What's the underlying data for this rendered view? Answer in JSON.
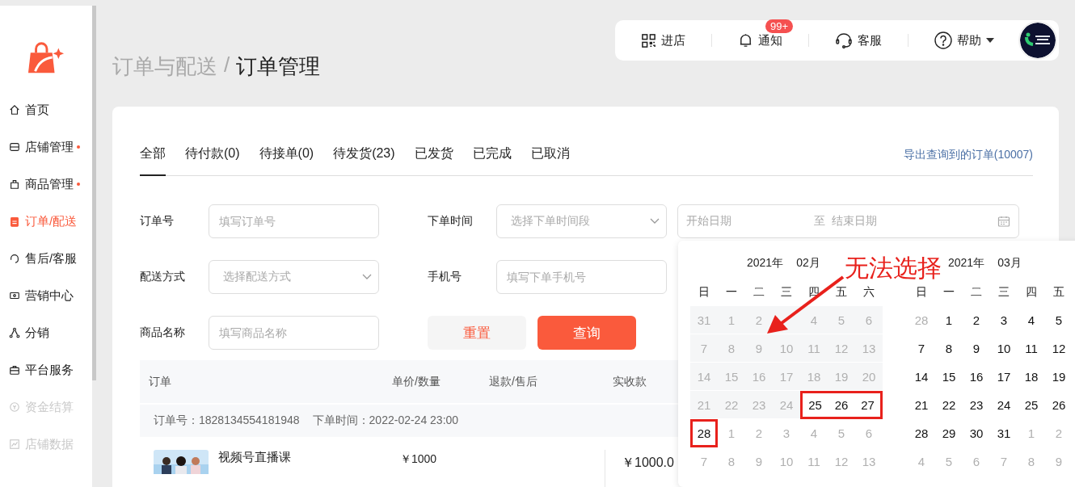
{
  "sidebar": {
    "items": [
      {
        "label": "首页",
        "dot": false,
        "selected": false,
        "disabled": false
      },
      {
        "label": "店铺管理",
        "dot": true,
        "selected": false,
        "disabled": false
      },
      {
        "label": "商品管理",
        "dot": true,
        "selected": false,
        "disabled": false
      },
      {
        "label": "订单/配送",
        "dot": false,
        "selected": true,
        "disabled": false
      },
      {
        "label": "售后/客服",
        "dot": false,
        "selected": false,
        "disabled": false
      },
      {
        "label": "营销中心",
        "dot": false,
        "selected": false,
        "disabled": false
      },
      {
        "label": "分销",
        "dot": false,
        "selected": false,
        "disabled": false
      },
      {
        "label": "平台服务",
        "dot": false,
        "selected": false,
        "disabled": false
      },
      {
        "label": "资金结算",
        "dot": false,
        "selected": false,
        "disabled": true
      },
      {
        "label": "店铺数据",
        "dot": false,
        "selected": false,
        "disabled": true
      }
    ]
  },
  "toolbar": [
    {
      "label": "进店"
    },
    {
      "label": "通知",
      "badge": "99+"
    },
    {
      "label": "客服"
    },
    {
      "label": "帮助",
      "dropdown": true
    }
  ],
  "breadcrumb": {
    "parent": "订单与配送",
    "separator": "/",
    "current": "订单管理"
  },
  "tabs": [
    {
      "label": "全部",
      "selected": true
    },
    {
      "label": "待付款(0)",
      "selected": false
    },
    {
      "label": "待接单(0)",
      "selected": false
    },
    {
      "label": "待发货(23)",
      "selected": false
    },
    {
      "label": "已发货",
      "selected": false
    },
    {
      "label": "已完成",
      "selected": false
    },
    {
      "label": "已取消",
      "selected": false
    }
  ],
  "export_link": "导出查询到的订单(10007)",
  "filters": {
    "order_no": {
      "label": "订单号",
      "placeholder": "填写订单号"
    },
    "order_time": {
      "label": "下单时间",
      "placeholder": "选择下单时间段",
      "start_placeholder": "开始日期",
      "range_separator": "至",
      "end_placeholder": "结束日期"
    },
    "delivery": {
      "label": "配送方式",
      "placeholder": "选择配送方式"
    },
    "phone": {
      "label": "手机号",
      "placeholder": "填写下单手机号"
    },
    "product": {
      "label": "商品名称",
      "placeholder": "填写商品名称"
    },
    "buttons": [
      "重置",
      "查询"
    ]
  },
  "table": {
    "columns": [
      "订单",
      "单价/数量",
      "退款/售后",
      "实收款"
    ],
    "order": {
      "no_label": "订单号：",
      "no": "1828134554181948",
      "time_label": "下单时间：",
      "time": "2022-02-24 23:00"
    },
    "item": {
      "name": "视频号直播课",
      "price": "￥1000",
      "paid": "￥1000.0"
    }
  },
  "calendar": {
    "months": [
      {
        "year": "2021年",
        "month": "02月",
        "weekdays": [
          "日",
          "一",
          "二",
          "三",
          "四",
          "五",
          "六"
        ],
        "weeks": [
          [
            {
              "day": "31",
              "kind": "disabled",
              "circled": false
            },
            {
              "day": "1",
              "kind": "disabled",
              "circled": false
            },
            {
              "day": "2",
              "kind": "disabled",
              "circled": false
            },
            {
              "kind": "disabled",
              "circled": false
            },
            {
              "day": "4",
              "kind": "disabled",
              "circled": false
            },
            {
              "day": "5",
              "kind": "disabled",
              "circled": false
            },
            {
              "day": "6",
              "kind": "disabled",
              "circled": false
            }
          ],
          [
            {
              "day": "7",
              "kind": "disabled",
              "circled": false
            },
            {
              "day": "8",
              "kind": "disabled",
              "circled": false
            },
            {
              "day": "9",
              "kind": "disabled",
              "circled": false
            },
            {
              "day": "10",
              "kind": "disabled",
              "circled": false
            },
            {
              "day": "11",
              "kind": "disabled",
              "circled": false
            },
            {
              "day": "12",
              "kind": "disabled",
              "circled": false
            },
            {
              "day": "13",
              "kind": "disabled",
              "circled": false
            }
          ],
          [
            {
              "day": "14",
              "kind": "disabled",
              "circled": false
            },
            {
              "day": "15",
              "kind": "disabled",
              "circled": false
            },
            {
              "day": "16",
              "kind": "disabled",
              "circled": false
            },
            {
              "day": "17",
              "kind": "disabled",
              "circled": false
            },
            {
              "day": "18",
              "kind": "disabled",
              "circled": false
            },
            {
              "day": "19",
              "kind": "disabled",
              "circled": false
            },
            {
              "day": "20",
              "kind": "disabled",
              "circled": false
            }
          ],
          [
            {
              "day": "21",
              "kind": "disabled",
              "circled": false
            },
            {
              "day": "22",
              "kind": "disabled",
              "circled": false
            },
            {
              "day": "23",
              "kind": "disabled",
              "circled": false
            },
            {
              "day": "24",
              "kind": "disabled",
              "circled": false
            },
            {
              "day": "25",
              "kind": "normal",
              "circled": true
            },
            {
              "day": "26",
              "kind": "normal",
              "circled": true
            },
            {
              "day": "27",
              "kind": "normal",
              "circled": true
            }
          ],
          [
            {
              "day": "28",
              "kind": "normal",
              "circled": true
            },
            {
              "day": "1",
              "kind": "outside",
              "circled": false
            },
            {
              "day": "2",
              "kind": "outside",
              "circled": false
            },
            {
              "day": "3",
              "kind": "outside",
              "circled": false
            },
            {
              "day": "4",
              "kind": "outside",
              "circled": false
            },
            {
              "day": "5",
              "kind": "outside",
              "circled": false
            },
            {
              "day": "6",
              "kind": "outside",
              "circled": false
            }
          ],
          [
            {
              "day": "7",
              "kind": "outside",
              "circled": false
            },
            {
              "day": "8",
              "kind": "outside",
              "circled": false
            },
            {
              "day": "9",
              "kind": "outside",
              "circled": false
            },
            {
              "day": "10",
              "kind": "outside",
              "circled": false
            },
            {
              "day": "11",
              "kind": "outside",
              "circled": false
            },
            {
              "day": "12",
              "kind": "outside",
              "circled": false
            },
            {
              "day": "13",
              "kind": "outside",
              "circled": false
            }
          ]
        ]
      },
      {
        "year": "2021年",
        "month": "03月",
        "weekdays": [
          "日",
          "一",
          "二",
          "三",
          "四",
          "五"
        ],
        "weeks": [
          [
            {
              "day": "28",
              "kind": "outside",
              "circled": false
            },
            {
              "day": "1",
              "kind": "normal",
              "circled": false
            },
            {
              "day": "2",
              "kind": "normal",
              "circled": false
            },
            {
              "day": "3",
              "kind": "normal",
              "circled": false
            },
            {
              "day": "4",
              "kind": "normal",
              "circled": false
            },
            {
              "day": "5",
              "kind": "normal",
              "circled": false
            }
          ],
          [
            {
              "day": "7",
              "kind": "normal",
              "circled": false
            },
            {
              "day": "8",
              "kind": "normal",
              "circled": false
            },
            {
              "day": "9",
              "kind": "normal",
              "circled": false
            },
            {
              "day": "10",
              "kind": "normal",
              "circled": false
            },
            {
              "day": "11",
              "kind": "normal",
              "circled": false
            },
            {
              "day": "12",
              "kind": "normal",
              "circled": false
            }
          ],
          [
            {
              "day": "14",
              "kind": "normal",
              "circled": false
            },
            {
              "day": "15",
              "kind": "normal",
              "circled": false
            },
            {
              "day": "16",
              "kind": "normal",
              "circled": false
            },
            {
              "day": "17",
              "kind": "normal",
              "circled": false
            },
            {
              "day": "18",
              "kind": "normal",
              "circled": false
            },
            {
              "day": "19",
              "kind": "normal",
              "circled": false
            }
          ],
          [
            {
              "day": "21",
              "kind": "normal",
              "circled": false
            },
            {
              "day": "22",
              "kind": "normal",
              "circled": false
            },
            {
              "day": "23",
              "kind": "normal",
              "circled": false
            },
            {
              "day": "24",
              "kind": "normal",
              "circled": false
            },
            {
              "day": "25",
              "kind": "normal",
              "circled": false
            },
            {
              "day": "26",
              "kind": "normal",
              "circled": false
            }
          ],
          [
            {
              "day": "28",
              "kind": "normal",
              "circled": false
            },
            {
              "day": "29",
              "kind": "normal",
              "circled": false
            },
            {
              "day": "30",
              "kind": "normal",
              "circled": false
            },
            {
              "day": "31",
              "kind": "normal",
              "circled": false
            },
            {
              "day": "1",
              "kind": "outside",
              "circled": false
            },
            {
              "day": "2",
              "kind": "outside",
              "circled": false
            }
          ],
          [
            {
              "day": "4",
              "kind": "outside",
              "circled": false
            },
            {
              "day": "5",
              "kind": "outside",
              "circled": false
            },
            {
              "day": "6",
              "kind": "outside",
              "circled": false
            },
            {
              "day": "7",
              "kind": "outside",
              "circled": false
            },
            {
              "day": "8",
              "kind": "outside",
              "circled": false
            },
            {
              "day": "9",
              "kind": "outside",
              "circled": false
            }
          ]
        ]
      }
    ],
    "annotation": "无法选择"
  }
}
